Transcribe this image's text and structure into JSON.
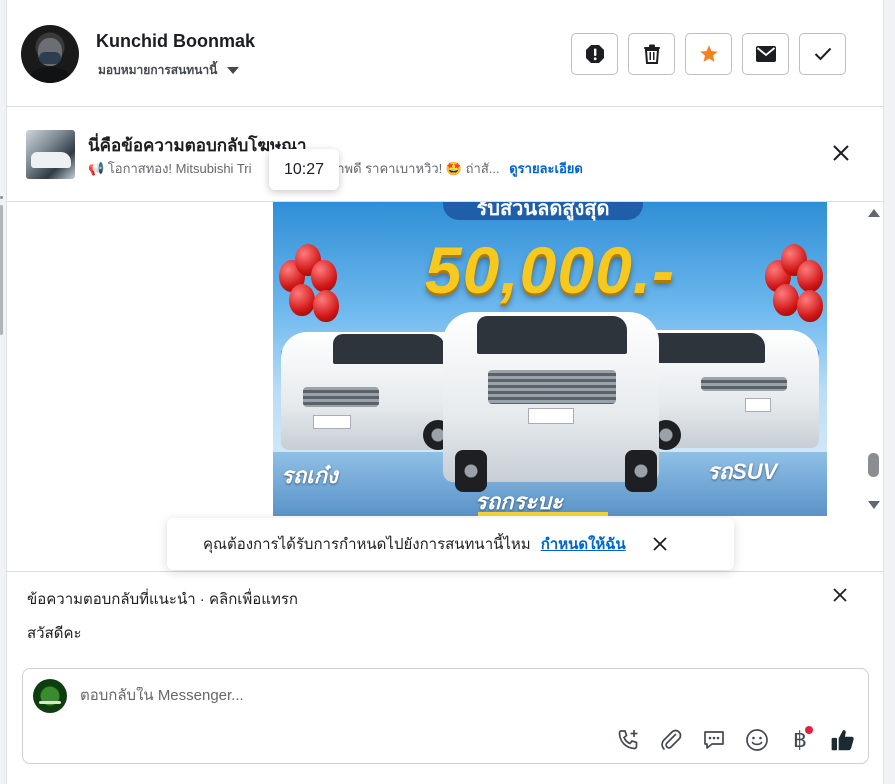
{
  "header": {
    "contact_name": "Kunchid Boonmak",
    "assign_label": "มอบหมายการสนทนานี้",
    "actions": [
      "spam-icon",
      "trash-icon",
      "star-icon",
      "mail-icon",
      "check-icon"
    ],
    "star_color": "#f5821f"
  },
  "ad_reply": {
    "title": "นี่คือข้อความตอบกลับโฆษณา",
    "snippet_before": "📢 โอกาสทอง! Mitsubishi Tri",
    "snippet_after": "สภาพดี ราคาเบาหวิว! 🤩 ถ่าสั...",
    "details_link": "ดูรายละเอียด",
    "tooltip_time": "10:27"
  },
  "promo_image": {
    "header_text": "รับส่วนลดสูงสุด",
    "amount": "50,000.-",
    "label_left": "รถเก๋ง",
    "label_center": "รถกระบะ",
    "label_right": "รถSUV"
  },
  "assign_prompt": {
    "question": "คุณต้องการได้รับการกำหนดไปยังการสนทนานี้ไหม",
    "action": "กำหนดให้ฉัน"
  },
  "suggested_replies": {
    "label": "ข้อความตอบกลับที่แนะนำ · คลิกเพื่อแทรก",
    "items": [
      "สวัสดีคะ"
    ]
  },
  "composer": {
    "placeholder": "ตอบกลับใน Messenger...",
    "value": "",
    "tools": [
      "phone-plus-icon",
      "paperclip-icon",
      "saved-reply-icon",
      "emoji-icon",
      "baht-icon",
      "thumbs-up-icon"
    ],
    "baht_symbol": "฿",
    "accent": "#0064d1"
  }
}
